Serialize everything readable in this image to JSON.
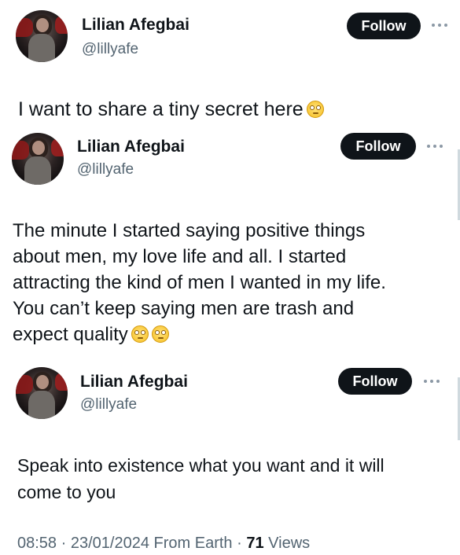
{
  "posts": [
    {
      "author_name": "Lilian Afegbai",
      "handle": "@lillyafe",
      "follow_label": "Follow",
      "text": "I want to share a tiny secret here",
      "emoji": [
        "face-with-rolling-eyes"
      ]
    },
    {
      "author_name": "Lilian Afegbai",
      "handle": "@lillyafe",
      "follow_label": "Follow",
      "text": "The minute I started saying positive things\nabout men, my love life and all. I started\nattracting the kind of men I wanted in my life.\nYou can’t keep saying men are trash and\nexpect quality",
      "emoji": [
        "face-with-rolling-eyes",
        "face-with-rolling-eyes"
      ]
    },
    {
      "author_name": "Lilian Afegbai",
      "handle": "@lillyafe",
      "follow_label": "Follow",
      "text": "Speak into existence what you want and it will\ncome to you",
      "emoji": []
    }
  ],
  "footer": {
    "time": "08:58",
    "date": "23/01/2024",
    "source": "From Earth",
    "views_count": "71",
    "views_label": "Views",
    "separator": "·"
  }
}
